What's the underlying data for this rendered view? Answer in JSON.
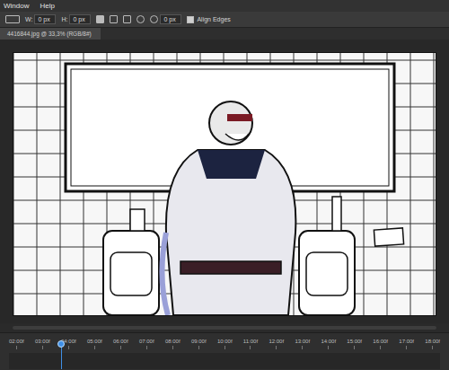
{
  "menu": [
    {
      "label": "Window"
    },
    {
      "label": "Help"
    }
  ],
  "toolbar": {
    "fields": [
      {
        "label": "W:",
        "value": "0 px"
      },
      {
        "label": "H:",
        "value": "0 px"
      }
    ],
    "radius": {
      "value": "0 px"
    },
    "align_edges": {
      "label": "Align Edges",
      "checked": true
    }
  },
  "document_tab": {
    "title": "4416844.jpg @ 33,3% (RGB/8#)",
    "selected": true
  },
  "timeline": {
    "ticks": [
      "02:00f",
      "03:00f",
      "04:00f",
      "05:00f",
      "06:00f",
      "07:00f",
      "08:00f",
      "09:00f",
      "10:00f",
      "11:00f",
      "12:00f",
      "13:00f",
      "14:00f",
      "15:00f",
      "16:00f",
      "17:00f",
      "18:00f"
    ],
    "playhead": {
      "level": 0.12
    }
  }
}
